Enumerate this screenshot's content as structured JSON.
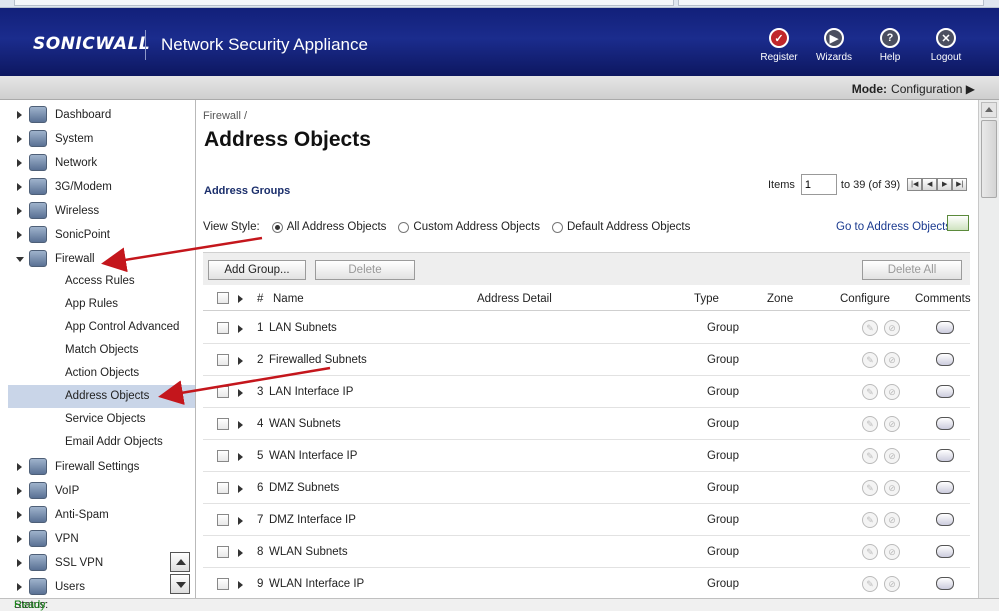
{
  "header": {
    "logo": "SONICWALL",
    "title": "Network Security Appliance",
    "buttons": [
      {
        "label": "Register",
        "icon": "check-icon"
      },
      {
        "label": "Wizards",
        "icon": "wizard-icon"
      },
      {
        "label": "Help",
        "icon": "help-icon"
      },
      {
        "label": "Logout",
        "icon": "logout-icon"
      }
    ]
  },
  "mode": {
    "label": "Mode:",
    "value": "Configuration ▶"
  },
  "sidebar": {
    "items": [
      {
        "label": "Dashboard",
        "icon": "dashboard-icon"
      },
      {
        "label": "System",
        "icon": "system-icon"
      },
      {
        "label": "Network",
        "icon": "network-icon"
      },
      {
        "label": "3G/Modem",
        "icon": "modem-icon"
      },
      {
        "label": "Wireless",
        "icon": "wireless-icon"
      },
      {
        "label": "SonicPoint",
        "icon": "sonicpoint-icon"
      },
      {
        "label": "Firewall",
        "icon": "firewall-icon"
      }
    ],
    "subitems": [
      {
        "label": "Access Rules"
      },
      {
        "label": "App Rules"
      },
      {
        "label": "App Control Advanced"
      },
      {
        "label": "Match Objects"
      },
      {
        "label": "Action Objects"
      },
      {
        "label": "Address Objects"
      },
      {
        "label": "Service Objects"
      },
      {
        "label": "Email Addr Objects"
      }
    ],
    "items_after": [
      {
        "label": "Firewall Settings",
        "icon": "firewall-settings-icon"
      },
      {
        "label": "VoIP",
        "icon": "voip-icon"
      },
      {
        "label": "Anti-Spam",
        "icon": "anti-spam-icon"
      },
      {
        "label": "VPN",
        "icon": "vpn-icon"
      },
      {
        "label": "SSL VPN",
        "icon": "ssl-vpn-icon"
      },
      {
        "label": "Users",
        "icon": "users-icon"
      }
    ]
  },
  "main": {
    "breadcrumb": "Firewall /",
    "title": "Address Objects",
    "section": "Address Groups",
    "pager": {
      "items_label": "Items",
      "items_value": "1",
      "range": "to 39 (of 39)"
    },
    "view_style": {
      "label": "View Style:",
      "options": [
        "All Address Objects",
        "Custom Address Objects",
        "Default Address Objects"
      ],
      "selected": "All Address Objects"
    },
    "goto_link": "Go to Address Objects",
    "toolbar": {
      "add_group": "Add Group...",
      "delete": "Delete",
      "delete_all": "Delete All"
    },
    "columns": {
      "num": "#",
      "name": "Name",
      "detail": "Address Detail",
      "type": "Type",
      "zone": "Zone",
      "configure": "Configure",
      "comments": "Comments"
    },
    "rows": [
      {
        "num": "1",
        "name": "LAN Subnets",
        "type": "Group"
      },
      {
        "num": "2",
        "name": "Firewalled Subnets",
        "type": "Group"
      },
      {
        "num": "3",
        "name": "LAN Interface IP",
        "type": "Group"
      },
      {
        "num": "4",
        "name": "WAN Subnets",
        "type": "Group"
      },
      {
        "num": "5",
        "name": "WAN Interface IP",
        "type": "Group"
      },
      {
        "num": "6",
        "name": "DMZ Subnets",
        "type": "Group"
      },
      {
        "num": "7",
        "name": "DMZ Interface IP",
        "type": "Group"
      },
      {
        "num": "8",
        "name": "WLAN Subnets",
        "type": "Group"
      },
      {
        "num": "9",
        "name": "WLAN Interface IP",
        "type": "Group"
      }
    ]
  },
  "status": {
    "label": "Status:",
    "value": "Ready"
  },
  "colors": {
    "header": "#12207a",
    "active_nav": "#c9d5e8",
    "annotation_arrow": "#c4161c",
    "link": "#1a3a8f"
  }
}
